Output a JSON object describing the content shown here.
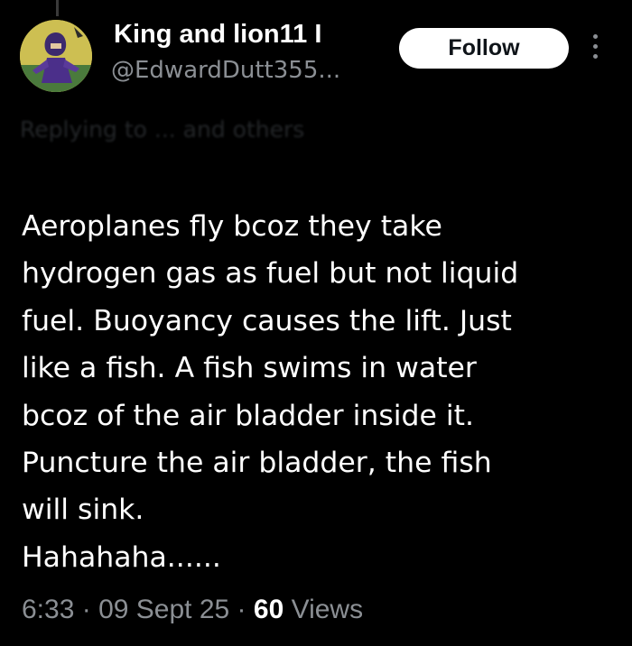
{
  "post": {
    "author": {
      "display_name": "King and lion11 I",
      "handle": "@EdwardDutt355..."
    },
    "follow_label": "Follow",
    "more_icon": "more-vertical-icon",
    "replying_to": "Replying to ... and others",
    "body_lines": [
      "Aeroplanes fly bcoz they take",
      "hydrogen gas as fuel but not liquid",
      "fuel. Buoyancy causes the lift. Just",
      "like a fish. A fish swims in water",
      "bcoz of the air bladder inside it.",
      "Puncture the air bladder, the fish",
      "will sink.",
      "Hahahaha......"
    ],
    "time": "6:33",
    "date": "09 Sept 25",
    "separator": "·",
    "views_count": "60",
    "views_label": "Views"
  },
  "colors": {
    "background": "#000000",
    "primary_text": "#ffffff",
    "secondary_text": "#8b8f94",
    "button_bg": "#ffffff",
    "button_text": "#0f1419"
  }
}
